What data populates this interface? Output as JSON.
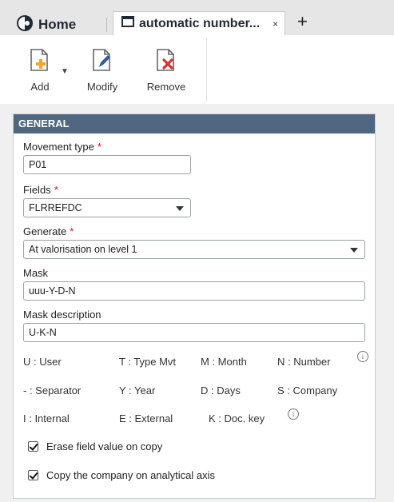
{
  "tabs": {
    "home_label": "Home",
    "active_label": "automatic number...",
    "close_glyph": "×",
    "add_glyph": "+"
  },
  "toolbar": {
    "add_label": "Add",
    "modify_label": "Modify",
    "remove_label": "Remove"
  },
  "section": {
    "title": "GENERAL"
  },
  "form": {
    "movement_type": {
      "label": "Movement type",
      "value": "P01",
      "required": "*"
    },
    "fields": {
      "label": "Fields",
      "value": "FLRREFDC",
      "required": "*"
    },
    "generate": {
      "label": "Generate",
      "value": "At valorisation on level 1",
      "required": "*"
    },
    "mask": {
      "label": "Mask",
      "value": "uuu-Y-D-N"
    },
    "mask_description": {
      "label": "Mask description",
      "value": "U-K-N"
    }
  },
  "legend": {
    "row1": [
      "U : User",
      "T : Type Mvt",
      "M : Month",
      "N : Number"
    ],
    "row2": [
      "- : Separator",
      "Y : Year",
      "D : Days",
      "S : Company"
    ],
    "row3": [
      "I : Internal",
      "E : External",
      "K : Doc. key"
    ]
  },
  "checkboxes": {
    "erase_label": "Erase field value on copy",
    "copy_company_label": "Copy the company on analytical axis"
  },
  "icons": {
    "info": "i"
  },
  "colors": {
    "header_bg": "#4f6781",
    "required": "#d11111",
    "add_accent": "#f6a623",
    "remove_accent": "#d9302c"
  }
}
